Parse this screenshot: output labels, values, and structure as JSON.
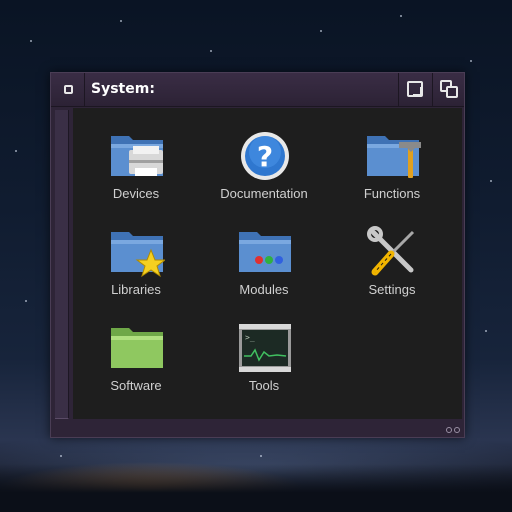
{
  "window": {
    "title": "System:"
  },
  "icons": [
    {
      "label": "Devices"
    },
    {
      "label": "Documentation"
    },
    {
      "label": "Functions"
    },
    {
      "label": "Libraries"
    },
    {
      "label": "Modules"
    },
    {
      "label": "Settings"
    },
    {
      "label": "Software"
    },
    {
      "label": "Tools"
    }
  ],
  "colors": {
    "folder_blue": "#5b8fd0",
    "folder_green": "#8fc860",
    "window_frame": "#2e2437",
    "content_bg": "#1e1e1e",
    "label_text": "#d0d0d0"
  }
}
